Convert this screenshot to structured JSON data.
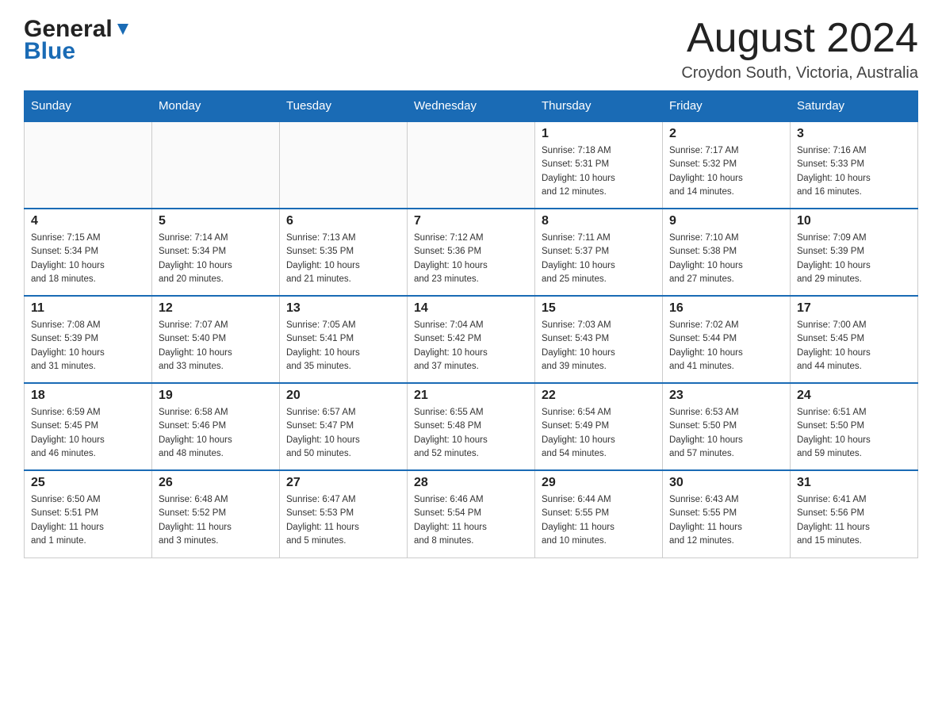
{
  "header": {
    "logo_general": "General",
    "logo_blue": "Blue",
    "month_title": "August 2024",
    "location": "Croydon South, Victoria, Australia"
  },
  "weekdays": [
    "Sunday",
    "Monday",
    "Tuesday",
    "Wednesday",
    "Thursday",
    "Friday",
    "Saturday"
  ],
  "weeks": [
    [
      {
        "day": "",
        "info": ""
      },
      {
        "day": "",
        "info": ""
      },
      {
        "day": "",
        "info": ""
      },
      {
        "day": "",
        "info": ""
      },
      {
        "day": "1",
        "info": "Sunrise: 7:18 AM\nSunset: 5:31 PM\nDaylight: 10 hours\nand 12 minutes."
      },
      {
        "day": "2",
        "info": "Sunrise: 7:17 AM\nSunset: 5:32 PM\nDaylight: 10 hours\nand 14 minutes."
      },
      {
        "day": "3",
        "info": "Sunrise: 7:16 AM\nSunset: 5:33 PM\nDaylight: 10 hours\nand 16 minutes."
      }
    ],
    [
      {
        "day": "4",
        "info": "Sunrise: 7:15 AM\nSunset: 5:34 PM\nDaylight: 10 hours\nand 18 minutes."
      },
      {
        "day": "5",
        "info": "Sunrise: 7:14 AM\nSunset: 5:34 PM\nDaylight: 10 hours\nand 20 minutes."
      },
      {
        "day": "6",
        "info": "Sunrise: 7:13 AM\nSunset: 5:35 PM\nDaylight: 10 hours\nand 21 minutes."
      },
      {
        "day": "7",
        "info": "Sunrise: 7:12 AM\nSunset: 5:36 PM\nDaylight: 10 hours\nand 23 minutes."
      },
      {
        "day": "8",
        "info": "Sunrise: 7:11 AM\nSunset: 5:37 PM\nDaylight: 10 hours\nand 25 minutes."
      },
      {
        "day": "9",
        "info": "Sunrise: 7:10 AM\nSunset: 5:38 PM\nDaylight: 10 hours\nand 27 minutes."
      },
      {
        "day": "10",
        "info": "Sunrise: 7:09 AM\nSunset: 5:39 PM\nDaylight: 10 hours\nand 29 minutes."
      }
    ],
    [
      {
        "day": "11",
        "info": "Sunrise: 7:08 AM\nSunset: 5:39 PM\nDaylight: 10 hours\nand 31 minutes."
      },
      {
        "day": "12",
        "info": "Sunrise: 7:07 AM\nSunset: 5:40 PM\nDaylight: 10 hours\nand 33 minutes."
      },
      {
        "day": "13",
        "info": "Sunrise: 7:05 AM\nSunset: 5:41 PM\nDaylight: 10 hours\nand 35 minutes."
      },
      {
        "day": "14",
        "info": "Sunrise: 7:04 AM\nSunset: 5:42 PM\nDaylight: 10 hours\nand 37 minutes."
      },
      {
        "day": "15",
        "info": "Sunrise: 7:03 AM\nSunset: 5:43 PM\nDaylight: 10 hours\nand 39 minutes."
      },
      {
        "day": "16",
        "info": "Sunrise: 7:02 AM\nSunset: 5:44 PM\nDaylight: 10 hours\nand 41 minutes."
      },
      {
        "day": "17",
        "info": "Sunrise: 7:00 AM\nSunset: 5:45 PM\nDaylight: 10 hours\nand 44 minutes."
      }
    ],
    [
      {
        "day": "18",
        "info": "Sunrise: 6:59 AM\nSunset: 5:45 PM\nDaylight: 10 hours\nand 46 minutes."
      },
      {
        "day": "19",
        "info": "Sunrise: 6:58 AM\nSunset: 5:46 PM\nDaylight: 10 hours\nand 48 minutes."
      },
      {
        "day": "20",
        "info": "Sunrise: 6:57 AM\nSunset: 5:47 PM\nDaylight: 10 hours\nand 50 minutes."
      },
      {
        "day": "21",
        "info": "Sunrise: 6:55 AM\nSunset: 5:48 PM\nDaylight: 10 hours\nand 52 minutes."
      },
      {
        "day": "22",
        "info": "Sunrise: 6:54 AM\nSunset: 5:49 PM\nDaylight: 10 hours\nand 54 minutes."
      },
      {
        "day": "23",
        "info": "Sunrise: 6:53 AM\nSunset: 5:50 PM\nDaylight: 10 hours\nand 57 minutes."
      },
      {
        "day": "24",
        "info": "Sunrise: 6:51 AM\nSunset: 5:50 PM\nDaylight: 10 hours\nand 59 minutes."
      }
    ],
    [
      {
        "day": "25",
        "info": "Sunrise: 6:50 AM\nSunset: 5:51 PM\nDaylight: 11 hours\nand 1 minute."
      },
      {
        "day": "26",
        "info": "Sunrise: 6:48 AM\nSunset: 5:52 PM\nDaylight: 11 hours\nand 3 minutes."
      },
      {
        "day": "27",
        "info": "Sunrise: 6:47 AM\nSunset: 5:53 PM\nDaylight: 11 hours\nand 5 minutes."
      },
      {
        "day": "28",
        "info": "Sunrise: 6:46 AM\nSunset: 5:54 PM\nDaylight: 11 hours\nand 8 minutes."
      },
      {
        "day": "29",
        "info": "Sunrise: 6:44 AM\nSunset: 5:55 PM\nDaylight: 11 hours\nand 10 minutes."
      },
      {
        "day": "30",
        "info": "Sunrise: 6:43 AM\nSunset: 5:55 PM\nDaylight: 11 hours\nand 12 minutes."
      },
      {
        "day": "31",
        "info": "Sunrise: 6:41 AM\nSunset: 5:56 PM\nDaylight: 11 hours\nand 15 minutes."
      }
    ]
  ]
}
